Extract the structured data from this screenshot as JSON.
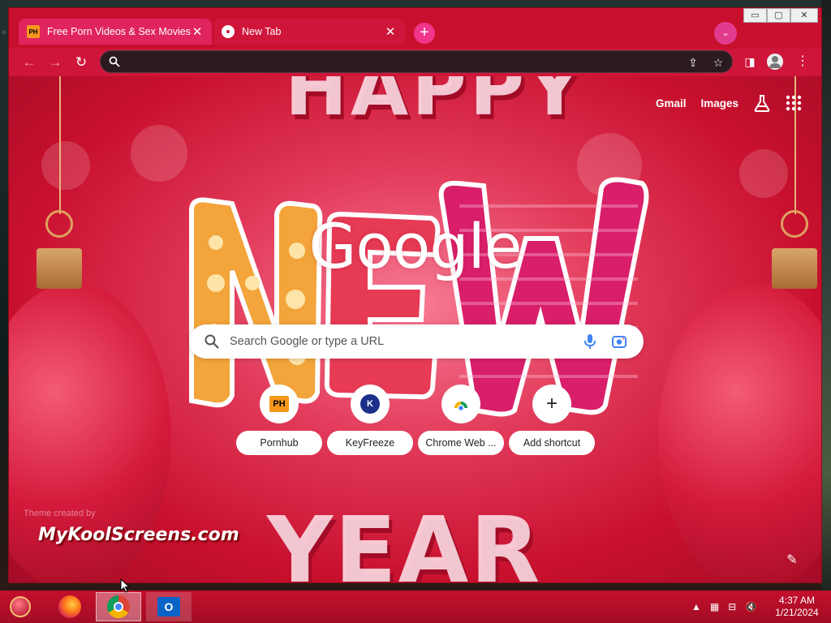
{
  "browser": {
    "tabs": [
      {
        "title": "Free Porn Videos & Sex Movies",
        "favicon": "PH",
        "active": false
      },
      {
        "title": "New Tab",
        "favicon": "chrome-icon",
        "active": true
      }
    ],
    "omnibox": {
      "value": "",
      "placeholder": ""
    },
    "window_controls": {
      "minimize": "▭",
      "maximize": "▢",
      "close": "✕"
    }
  },
  "ntp": {
    "top_links": {
      "gmail": "Gmail",
      "images": "Images"
    },
    "logo": "Google",
    "search": {
      "placeholder": "Search Google or type a URL"
    },
    "shortcuts": [
      {
        "label": "Pornhub",
        "icon": "PH"
      },
      {
        "label": "KeyFreeze",
        "icon": "K"
      },
      {
        "label": "Chrome Web ...",
        "icon": "chrome-web-store-icon"
      },
      {
        "label": "Add shortcut",
        "icon": "+"
      }
    ],
    "theme_credit": "Theme created by",
    "watermark": "MyKoolScreens.com",
    "decor": {
      "top": "HAPPY",
      "middle": "NEW",
      "bottom": "YEAR"
    }
  },
  "taskbar": {
    "time": "4:37 AM",
    "date": "1/21/2024",
    "apps": [
      "start-icon",
      "firefox-icon",
      "chrome-icon",
      "outlook-icon"
    ],
    "outlook_letter": "O"
  },
  "colors": {
    "theme_red": "#c8102e",
    "tab_pink": "#e0245e",
    "omnibox_bg": "#2b1a20"
  }
}
